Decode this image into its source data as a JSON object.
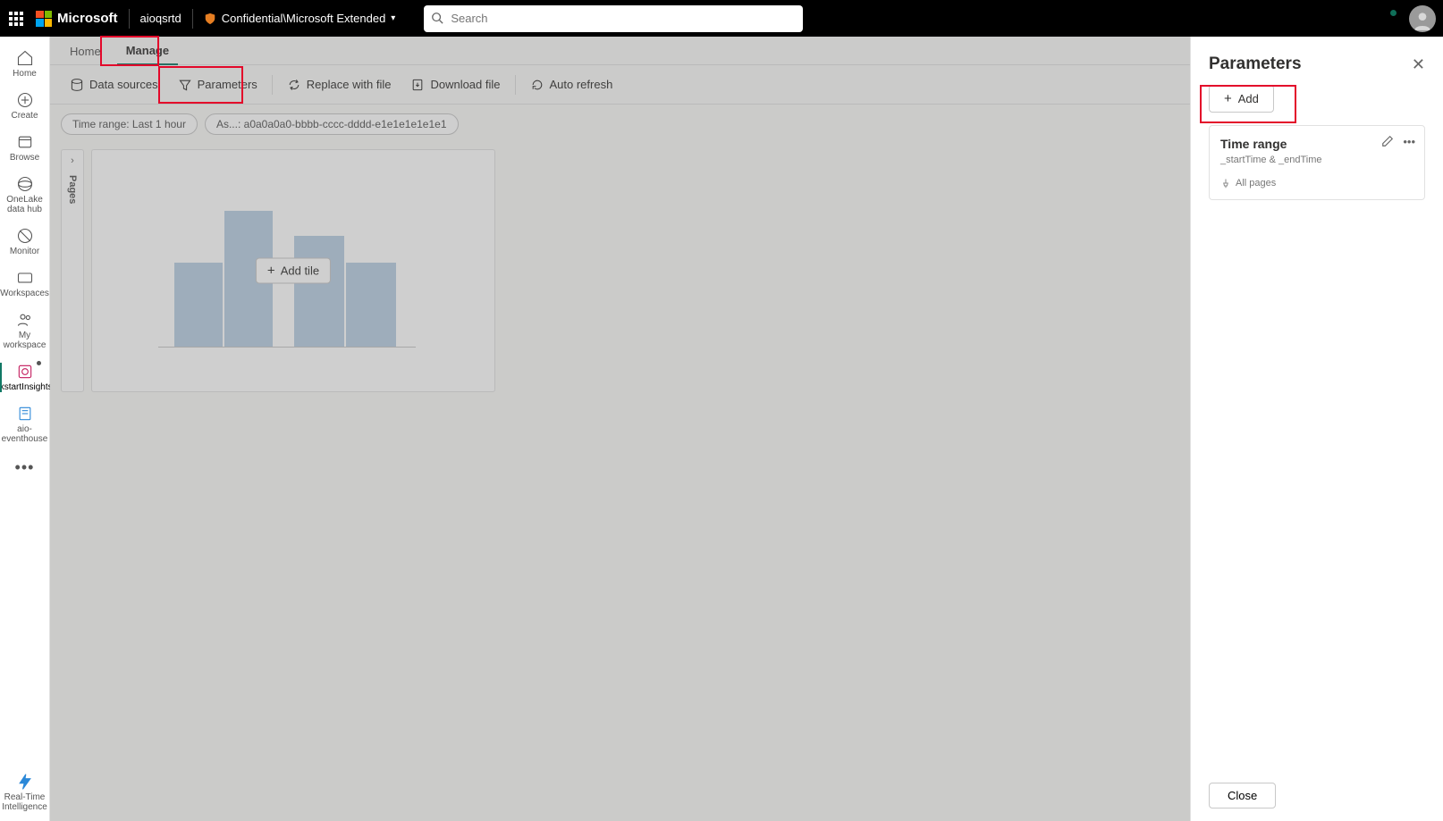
{
  "header": {
    "brand": "Microsoft",
    "tenant": "aioqsrtd",
    "sensitivity_label": "Confidential\\Microsoft Extended",
    "search_placeholder": "Search"
  },
  "leftnav": {
    "items": [
      {
        "label": "Home"
      },
      {
        "label": "Create"
      },
      {
        "label": "Browse"
      },
      {
        "label": "OneLake data hub"
      },
      {
        "label": "Monitor"
      },
      {
        "label": "Workspaces"
      },
      {
        "label": "My workspace"
      },
      {
        "label": "QuickstartInsightsAIO"
      },
      {
        "label": "aio-eventhouse"
      }
    ],
    "bottom_label": "Real-Time Intelligence"
  },
  "tabs": {
    "home": "Home",
    "manage": "Manage"
  },
  "toolbar": {
    "data_sources": "Data sources",
    "parameters": "Parameters",
    "replace_file": "Replace with file",
    "download_file": "Download file",
    "auto_refresh": "Auto refresh"
  },
  "pills": {
    "time_range": "Time range: Last 1 hour",
    "asset": "As...: a0a0a0a0-bbbb-cccc-dddd-e1e1e1e1e1e1"
  },
  "canvas": {
    "pages_label": "Pages",
    "add_tile": "Add tile"
  },
  "panel": {
    "title": "Parameters",
    "add": "Add",
    "card": {
      "title": "Time range",
      "sub": "_startTime & _endTime",
      "scope": "All pages"
    },
    "close": "Close"
  }
}
